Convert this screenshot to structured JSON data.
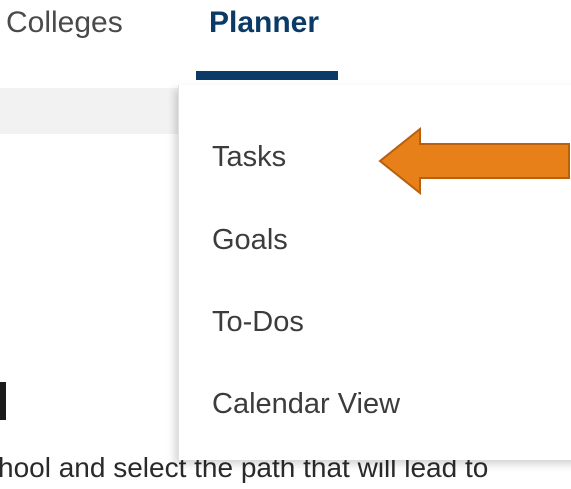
{
  "nav": {
    "tabs": [
      {
        "label": "Colleges"
      },
      {
        "label": "Planner",
        "active": true
      }
    ]
  },
  "dropdown": {
    "items": [
      {
        "label": "Tasks"
      },
      {
        "label": "Goals"
      },
      {
        "label": "To-Dos"
      },
      {
        "label": "Calendar View"
      }
    ]
  },
  "background": {
    "body_text": "hool and select the path that will lead to"
  },
  "annotation": {
    "arrow_color": "#e8801a",
    "arrow_target": "Tasks"
  },
  "colors": {
    "brand": "#0b3a66"
  }
}
